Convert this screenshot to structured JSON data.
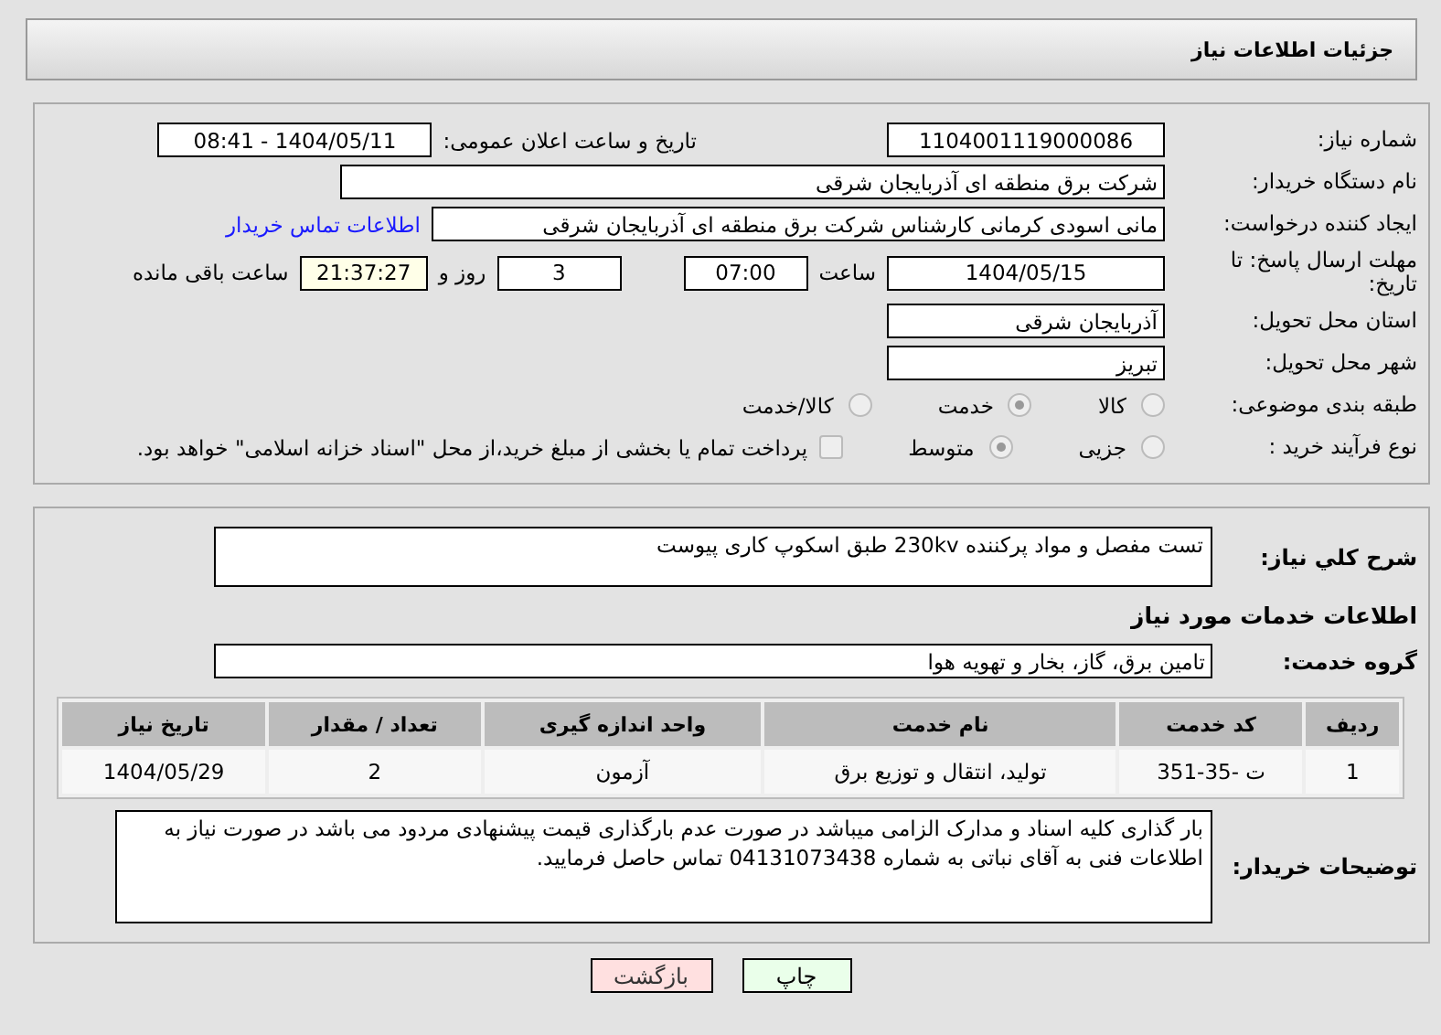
{
  "header": {
    "title": "جزئیات اطلاعات نیاز"
  },
  "need_number": {
    "label": "شماره نیاز:",
    "value": "1104001119000086"
  },
  "announce": {
    "label": "تاریخ و ساعت اعلان عمومی:",
    "value": "1404/05/11 - 08:41"
  },
  "buyer": {
    "label": "نام دستگاه خریدار:",
    "value": "شرکت برق منطقه ای آذربایجان شرقی"
  },
  "creator": {
    "label": "ایجاد کننده درخواست:",
    "value": "مانی اسودی کرمانی کارشناس شرکت برق منطقه ای آذربایجان شرقی",
    "link": "اطلاعات تماس خریدار"
  },
  "deadline": {
    "label": "مهلت ارسال پاسخ: تا تاریخ:",
    "date": "1404/05/15",
    "time_label": "ساعت",
    "time": "07:00",
    "days": "3",
    "days_label": "روز و",
    "remaining": "21:37:27",
    "remaining_label": "ساعت باقی مانده"
  },
  "province": {
    "label": "استان محل تحویل:",
    "value": "آذربایجان شرقی"
  },
  "city": {
    "label": "شهر محل تحویل:",
    "value": "تبریز"
  },
  "category": {
    "label": "طبقه بندی موضوعی:",
    "options": [
      {
        "label": "کالا",
        "selected": false
      },
      {
        "label": "خدمت",
        "selected": true
      },
      {
        "label": "کالا/خدمت",
        "selected": false
      }
    ]
  },
  "process": {
    "label": "نوع فرآیند خرید :",
    "options": [
      {
        "label": "جزیی",
        "selected": false
      },
      {
        "label": "متوسط",
        "selected": true
      }
    ],
    "payment": {
      "label": "پرداخت تمام یا بخشی از مبلغ خرید،از محل \"اسناد خزانه اسلامی\" خواهد بود.",
      "checked": false
    }
  },
  "summary": {
    "label": "شرح کلي نياز:",
    "value": "تست مفصل و مواد پرکننده 230kv طبق اسکوپ کاری پیوست"
  },
  "services_heading": "اطلاعات خدمات مورد نیاز",
  "service_group": {
    "label": "گروه خدمت:",
    "value": "تامین برق، گاز، بخار و تهویه هوا"
  },
  "table": {
    "columns": [
      "ردیف",
      "کد خدمت",
      "نام خدمت",
      "واحد اندازه گیری",
      "تعداد / مقدار",
      "تاریخ نیاز"
    ],
    "rows": [
      [
        "1",
        "ت -35-351",
        "تولید، انتقال و توزیع برق",
        "آزمون",
        "2",
        "1404/05/29"
      ]
    ]
  },
  "notes": {
    "label": "توضیحات خریدار:",
    "value": "بار گذاری کلیه اسناد و مدارک الزامی میباشد در صورت عدم بارگذاری قیمت پیشنهادی مردود می باشد در صورت نیاز به اطلاعات فنی به آقای نباتی به شماره 04131073438 تماس حاصل فرمایید."
  },
  "buttons": [
    {
      "label": "چاپ",
      "kind": "print"
    },
    {
      "label": "بازگشت",
      "kind": "back"
    }
  ]
}
